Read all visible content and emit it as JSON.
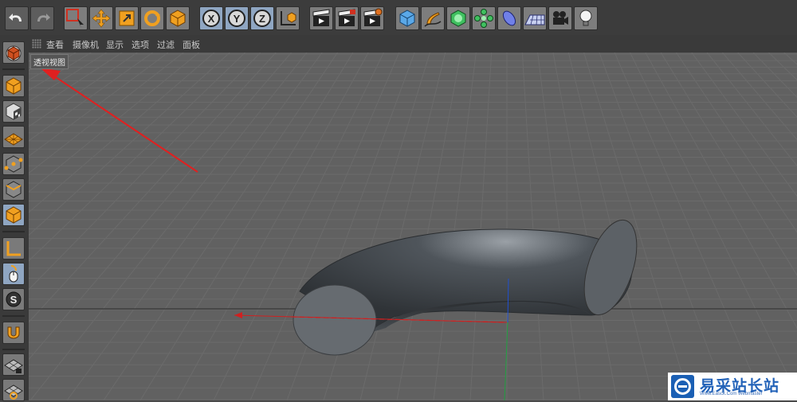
{
  "menubar": {
    "items": [
      {
        "key": "view",
        "label": "查看"
      },
      {
        "key": "camera",
        "label": "摄像机"
      },
      {
        "key": "display",
        "label": "显示"
      },
      {
        "key": "options",
        "label": "选项"
      },
      {
        "key": "filter",
        "label": "过滤"
      },
      {
        "key": "panel",
        "label": "面板"
      }
    ]
  },
  "viewport": {
    "label": "透视视图"
  },
  "toolbar": {
    "axis_x": "X",
    "axis_y": "Y",
    "axis_z": "Z"
  },
  "sidebar": {
    "snap_label": "S"
  },
  "watermark": {
    "title": "易采站长站",
    "subtitle": "Www.Easck.Com Webmaster"
  },
  "colors": {
    "accent_orange": "#e8a020",
    "axis_red": "#d02020",
    "axis_green": "#20a040",
    "axis_blue": "#2050d0",
    "annotation_arrow": "#e02020",
    "torus": "#3f4449",
    "watermark_blue": "#2262b8"
  },
  "icons": [
    "undo-icon",
    "redo-icon",
    "live-select-icon",
    "move-icon",
    "scale-icon",
    "rotate-icon",
    "recent-object-icon",
    "x-axis-icon",
    "y-axis-icon",
    "z-axis-icon",
    "world-coordinate-icon",
    "render-view-icon",
    "render-picture-viewer-icon",
    "render-settings-icon",
    "cube-primitive-icon",
    "pen-spline-icon",
    "subdivision-surface-icon",
    "array-icon",
    "deformer-icon",
    "floor-icon",
    "camera-icon",
    "light-icon",
    "make-editable-icon",
    "model-mode-icon",
    "texture-mode-icon",
    "workplane-icon",
    "points-mode-icon",
    "edges-mode-icon",
    "polygons-mode-icon",
    "axis-mode-icon",
    "tweak-mode-icon",
    "snap-icon",
    "magnet-icon",
    "lock-workplane-icon",
    "planar-workplane-icon"
  ]
}
